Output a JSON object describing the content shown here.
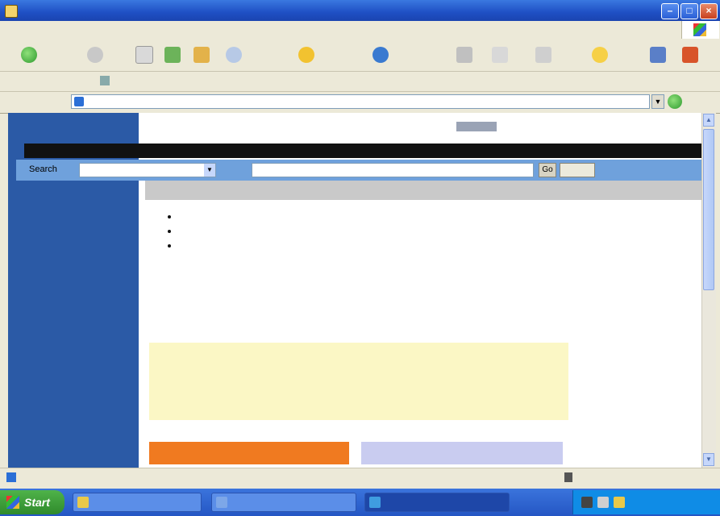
{
  "window": {
    "title": "",
    "controls": [
      "minimize",
      "maximize",
      "close"
    ]
  },
  "menubar": {
    "items": [
      "",
      "",
      "",
      "",
      "",
      ""
    ]
  },
  "toolbar": {
    "back_label": "",
    "buttons": [
      {
        "icon": "back-icon",
        "label": ""
      },
      {
        "icon": "forward-icon",
        "label": ""
      },
      {
        "icon": "stop-icon",
        "label": ""
      },
      {
        "icon": "refresh-icon",
        "label": ""
      },
      {
        "icon": "home-icon",
        "label": ""
      },
      {
        "icon": "search-icon",
        "label": ""
      },
      {
        "icon": "favorites-icon",
        "label": ""
      },
      {
        "icon": "media-icon",
        "label": ""
      },
      {
        "icon": "history-icon",
        "label": ""
      },
      {
        "icon": "mail-icon",
        "label": ""
      },
      {
        "icon": "print-icon",
        "label": ""
      },
      {
        "icon": "edit-icon",
        "label": ""
      },
      {
        "icon": "messenger-icon",
        "label": ""
      }
    ]
  },
  "linksbar": {
    "label": ""
  },
  "addressbar": {
    "label": "",
    "url": "",
    "go_label": ""
  },
  "site": {
    "logo": "",
    "header_search": "",
    "nav": [
      "",
      "",
      "",
      "",
      "",
      "",
      "",
      "",
      "",
      "",
      ""
    ],
    "search": {
      "label": "Search",
      "select_value": "",
      "for_label": "",
      "go_label": "Go",
      "go2_label": ""
    },
    "tabs": [
      "",
      "",
      "",
      "",
      ""
    ],
    "sidebar": {
      "links": [
        "",
        ""
      ],
      "section1_head": "",
      "section1_items": [
        "",
        "",
        "",
        "",
        ""
      ],
      "section2_head": "",
      "section2_items": [
        "",
        "",
        "",
        ""
      ]
    },
    "bullets": [
      {
        "before": "",
        "link": "",
        "after": ""
      },
      {
        "before": "",
        "link": "",
        "after": ""
      },
      {
        "before": "",
        "link": "",
        "after": ""
      }
    ],
    "notice": "",
    "orange_bar": "",
    "lavender_bar": ""
  },
  "statusbar": {
    "text": "",
    "zone": ""
  },
  "taskbar": {
    "start_label": "Start",
    "tasks": [
      {
        "label": "",
        "color": "#7da7e8"
      },
      {
        "label": "",
        "color": "#e9c94a"
      },
      {
        "label": "",
        "color": "#3f9de0"
      }
    ],
    "clock": ""
  }
}
